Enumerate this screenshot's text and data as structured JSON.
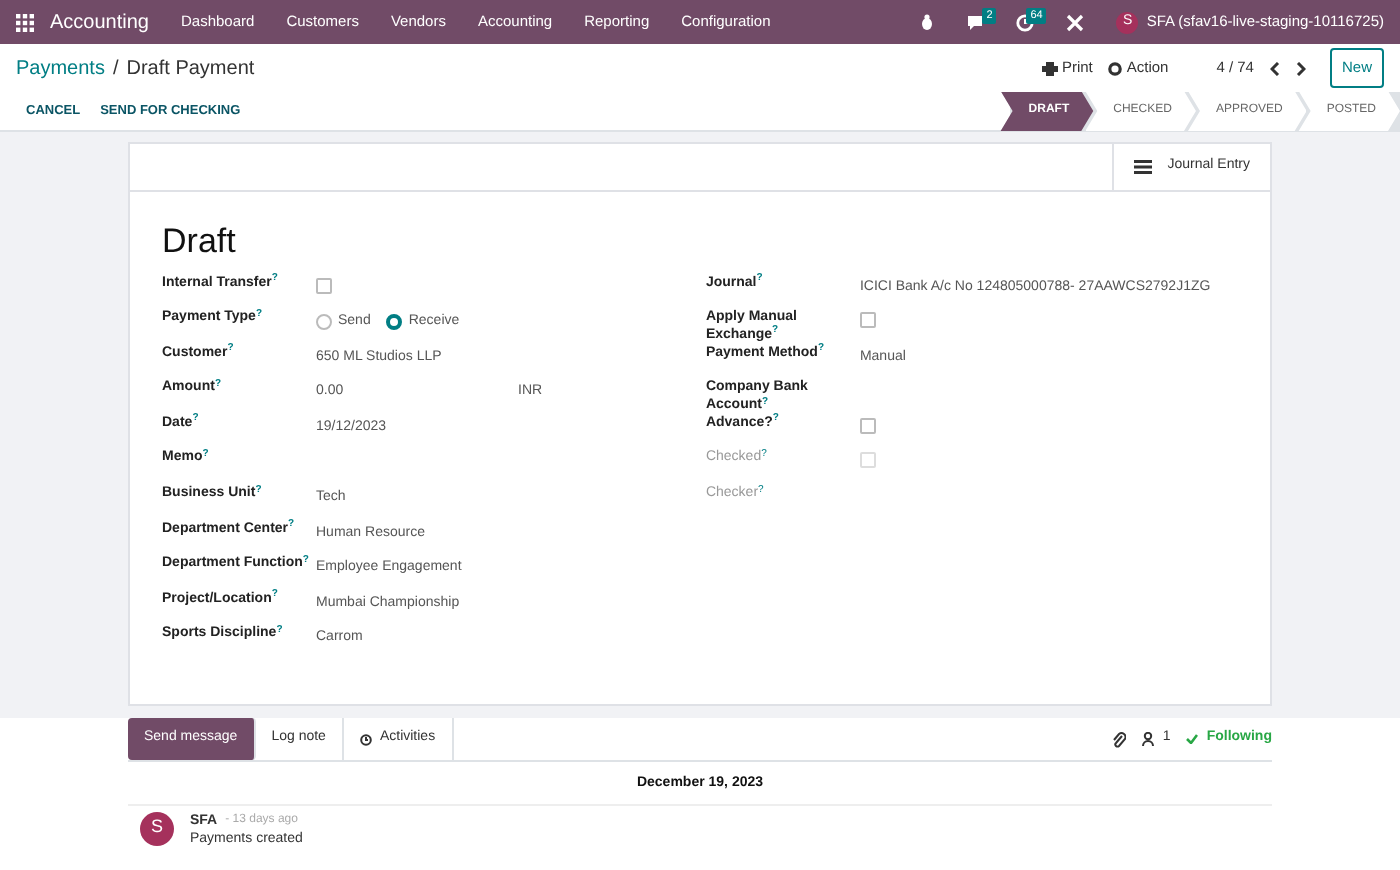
{
  "navbar": {
    "app": "Accounting",
    "menu": [
      "Dashboard",
      "Customers",
      "Vendors",
      "Accounting",
      "Reporting",
      "Configuration"
    ],
    "messages_count": "2",
    "activities_count": "64",
    "avatar": "S",
    "user": "SFA (sfav16-live-staging-10116725)"
  },
  "control_panel": {
    "breadcrumb": [
      "Payments",
      "Draft Payment"
    ],
    "separator": "/",
    "print": "Print",
    "action": "Action",
    "pager": "4 / 74",
    "new": "New"
  },
  "status_bar": {
    "buttons": [
      "CANCEL",
      "SEND FOR CHECKING"
    ],
    "stages": [
      {
        "label": "DRAFT",
        "selected": true
      },
      {
        "label": "CHECKED",
        "selected": false
      },
      {
        "label": "APPROVED",
        "selected": false
      },
      {
        "label": "POSTED",
        "selected": false
      }
    ]
  },
  "sheet": {
    "smart_button": "Journal Entry",
    "title": "Draft",
    "left_fields": [
      {
        "kind": "checkbox",
        "label": "Internal Transfer$^{?}$",
        "checked": false,
        "disabled": false
      },
      {
        "kind": "radio",
        "label": "Payment Type$^{?}$",
        "options": [
          {
            "label": "Send",
            "selected": false
          },
          {
            "label": "Receive",
            "selected": true
          }
        ]
      },
      {
        "kind": "text",
        "label": "Customer$^{?}$",
        "value": "650 ML Studios LLP",
        "disabled": false
      },
      {
        "kind": "amount",
        "label": "Amount$^{?}$",
        "value": "0.00",
        "currency": "INR"
      },
      {
        "kind": "text",
        "label": "Date$^{?}$",
        "value": "19/12/2023",
        "disabled": false
      },
      {
        "kind": "text",
        "label": "Memo$^{?}$",
        "disabled": false
      },
      {
        "kind": "text",
        "label": "Business Unit$^{?}$",
        "value": "Tech",
        "disabled": false
      },
      {
        "kind": "text",
        "label": "Department Center$^{?}$",
        "value": "Human Resource",
        "disabled": false
      },
      {
        "kind": "text",
        "label": "Department Function$^{?}$",
        "value": "Employee Engagement",
        "disabled": false
      },
      {
        "kind": "text",
        "label": "Project/Location$^{?}$",
        "value": "Mumbai Championship",
        "disabled": false
      },
      {
        "kind": "text",
        "label": "Sports Discipline$^{?}$",
        "value": "Carrom",
        "disabled": false
      }
    ],
    "right_fields": [
      {
        "kind": "text",
        "label": "Journal$^{?}$",
        "value": "ICICI Bank A/c No 124805000788- 27AAWCS2792J1ZG",
        "disabled": false
      },
      {
        "kind": "checkbox",
        "label": "Apply Manual Exchange$^{?}$",
        "checked": false,
        "disabled": false
      },
      {
        "kind": "text",
        "label": "Payment Method$^{?}$",
        "value": "Manual",
        "disabled": false
      },
      {
        "kind": "text",
        "label": "Company Bank Account$^{?}$",
        "disabled": false
      },
      {
        "kind": "checkbox",
        "label": "Advance?$^{?}$",
        "checked": false,
        "disabled": false
      },
      {
        "kind": "checkbox",
        "label": "Checked$^{?}$",
        "checked": false,
        "disabled": true
      },
      {
        "kind": "text",
        "label": "Checker$^{?}$",
        "disabled": true
      }
    ]
  },
  "chatter": {
    "tabs": [
      {
        "label": "Send message",
        "selected": true
      },
      {
        "label": "Log note",
        "selected": false
      },
      {
        "label": "Activities",
        "selected": false
      }
    ],
    "followers_count": "1",
    "following": "Following",
    "date": "December 19, 2023",
    "message": {
      "avatar": "S",
      "author": "SFA",
      "time": "- 13 days ago",
      "body": "Payments created"
    }
  }
}
